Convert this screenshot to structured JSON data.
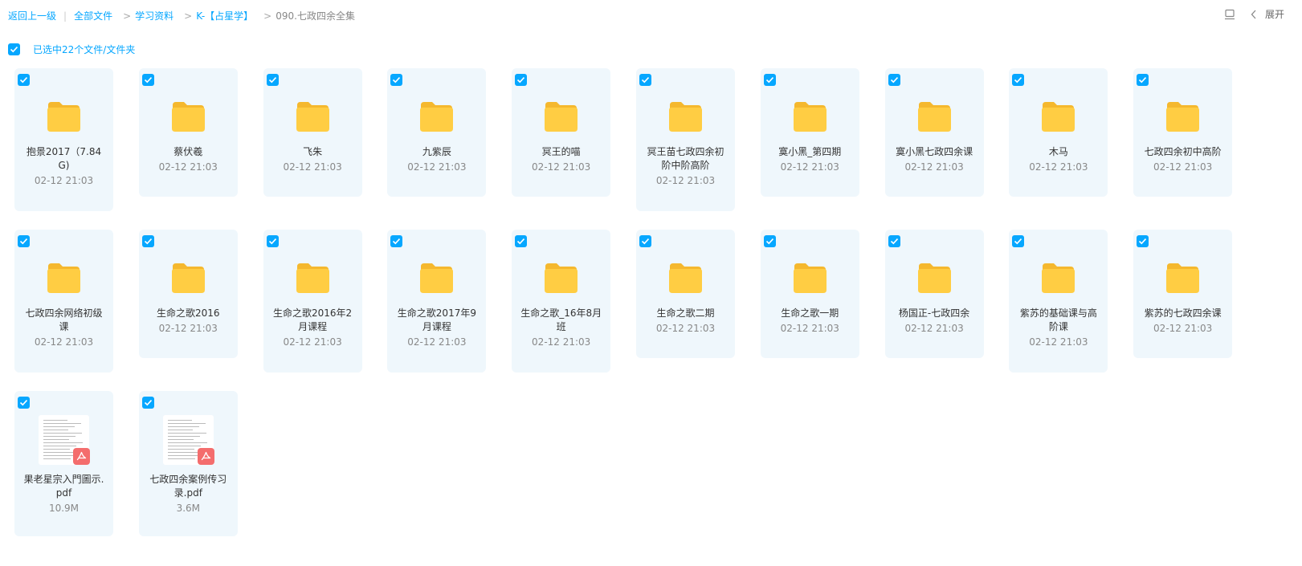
{
  "breadcrumb": {
    "back": "返回上一级",
    "items": [
      "全部文件",
      "学习资料",
      "K-【占星学】"
    ],
    "current": "090.七政四余全集"
  },
  "toolbar": {
    "expand_label": "展开"
  },
  "selection": {
    "text": "已选中22个文件/文件夹"
  },
  "colors": {
    "accent": "#06a7ff",
    "card_bg": "#eff7fc",
    "folder": "#ffc83d",
    "pdf": "#f46d6d"
  },
  "items": [
    {
      "name": "抱景2017（7.84G)",
      "meta": "02-12 21:03",
      "type": "folder"
    },
    {
      "name": "蔡伏羲",
      "meta": "02-12 21:03",
      "type": "folder"
    },
    {
      "name": "飞朱",
      "meta": "02-12 21:03",
      "type": "folder"
    },
    {
      "name": "九紫辰",
      "meta": "02-12 21:03",
      "type": "folder"
    },
    {
      "name": "冥王的喵",
      "meta": "02-12 21:03",
      "type": "folder"
    },
    {
      "name": "冥王苗七政四余初阶中阶高阶",
      "meta": "02-12 21:03",
      "type": "folder"
    },
    {
      "name": "寞小黑_第四期",
      "meta": "02-12 21:03",
      "type": "folder"
    },
    {
      "name": "寞小黑七政四余课",
      "meta": "02-12 21:03",
      "type": "folder"
    },
    {
      "name": "木马",
      "meta": "02-12 21:03",
      "type": "folder"
    },
    {
      "name": "七政四余初中高阶",
      "meta": "02-12 21:03",
      "type": "folder"
    },
    {
      "name": "七政四余网络初级课",
      "meta": "02-12 21:03",
      "type": "folder"
    },
    {
      "name": "生命之歌2016",
      "meta": "02-12 21:03",
      "type": "folder"
    },
    {
      "name": "生命之歌2016年2月课程",
      "meta": "02-12 21:03",
      "type": "folder"
    },
    {
      "name": "生命之歌2017年9月课程",
      "meta": "02-12 21:03",
      "type": "folder"
    },
    {
      "name": "生命之歌_16年8月班",
      "meta": "02-12 21:03",
      "type": "folder"
    },
    {
      "name": "生命之歌二期",
      "meta": "02-12 21:03",
      "type": "folder"
    },
    {
      "name": "生命之歌一期",
      "meta": "02-12 21:03",
      "type": "folder"
    },
    {
      "name": "杨国正-七政四余",
      "meta": "02-12 21:03",
      "type": "folder"
    },
    {
      "name": "紫苏的基础课与高阶课",
      "meta": "02-12 21:03",
      "type": "folder"
    },
    {
      "name": "紫苏的七政四余课",
      "meta": "02-12 21:03",
      "type": "folder"
    },
    {
      "name": "果老星宗入門圖示.pdf",
      "meta": "10.9M",
      "type": "pdf"
    },
    {
      "name": "七政四余案例传习录.pdf",
      "meta": "3.6M",
      "type": "pdf"
    }
  ],
  "layout_hint_heights": {}
}
